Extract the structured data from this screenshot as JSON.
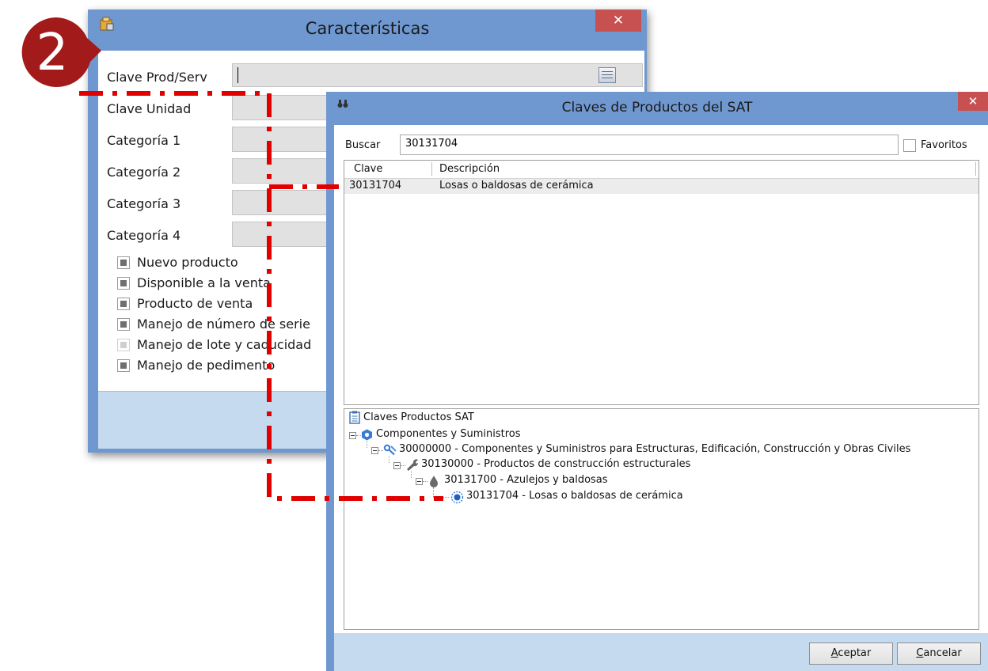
{
  "badge": {
    "number": "2"
  },
  "caracteristicas": {
    "title": "Características",
    "close_glyph": "✕",
    "fields": [
      {
        "label": "Clave Prod/Serv"
      },
      {
        "label": "Clave Unidad"
      },
      {
        "label": "Categoría 1"
      },
      {
        "label": "Categoría 2"
      },
      {
        "label": "Categoría 3"
      },
      {
        "label": "Categoría 4"
      }
    ],
    "checkboxes": [
      {
        "label": "Nuevo producto",
        "state": "indeterminate"
      },
      {
        "label": "Disponible a la venta",
        "state": "indeterminate"
      },
      {
        "label": "Producto de venta",
        "state": "indeterminate"
      },
      {
        "label": "Manejo de número de serie",
        "state": "indeterminate"
      },
      {
        "label": "Manejo de lote y caducidad",
        "state": "disabled"
      },
      {
        "label": "Manejo de pedimento",
        "state": "indeterminate"
      }
    ]
  },
  "claves_dialog": {
    "title": "Claves de Productos del SAT",
    "close_glyph": "✕",
    "search": {
      "label": "Buscar",
      "value": "30131704"
    },
    "favoritos": {
      "label": "Favoritos",
      "checked": false
    },
    "grid": {
      "columns": [
        "Clave",
        "Descripción"
      ],
      "rows": [
        {
          "clave": "30131704",
          "descripcion": "Losas o baldosas de cerámica"
        }
      ]
    },
    "tree": {
      "root": "Claves Productos SAT",
      "nodes": [
        "Componentes y Suministros",
        "30000000 - Componentes y Suministros para Estructuras, Edificación, Construcción y Obras Civiles",
        "30130000 - Productos de construcción estructurales",
        "30131700 - Azulejos y baldosas",
        "30131704 - Losas o baldosas de cerámica"
      ]
    },
    "buttons": {
      "accept_prefix": "A",
      "accept_rest": "ceptar",
      "cancel_prefix": "C",
      "cancel_rest": "ancelar"
    }
  },
  "colors": {
    "title_bar": "#6f98d0",
    "close_button": "#c75050",
    "badge": "#a31a1a",
    "annotation_line": "#e00000"
  }
}
